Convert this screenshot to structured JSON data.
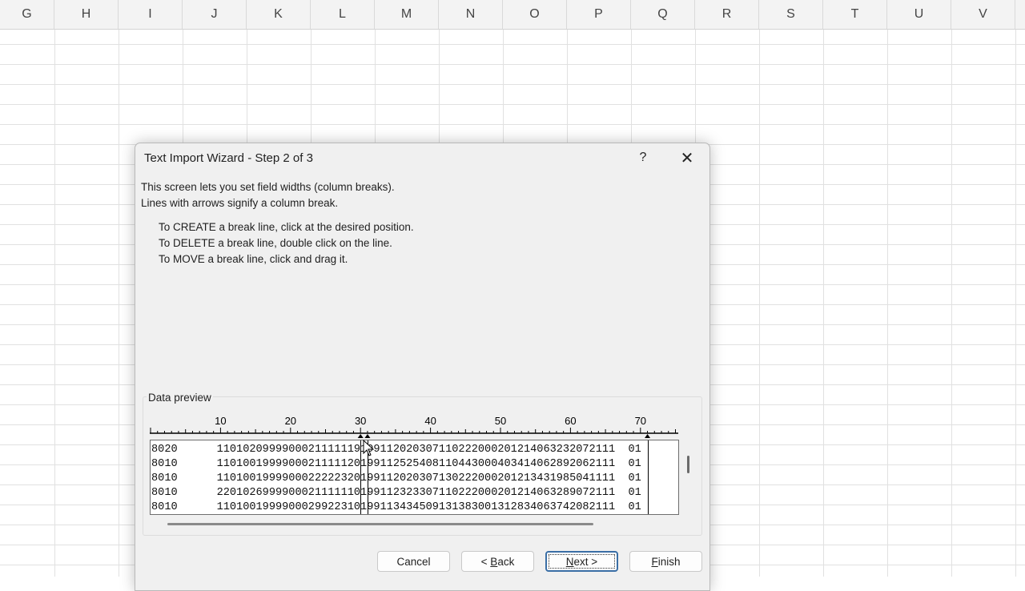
{
  "sheet": {
    "columns": [
      "G",
      "H",
      "I",
      "J",
      "K",
      "L",
      "M",
      "N",
      "O",
      "P",
      "Q",
      "R",
      "S",
      "T",
      "U",
      "V"
    ]
  },
  "dialog": {
    "title": "Text Import Wizard - Step 2 of 3",
    "help_label": "?",
    "close_label": "✕",
    "intro_line1": "This screen lets you set field widths (column breaks).",
    "intro_line2": "Lines with arrows signify a column break.",
    "instruction_create": "To CREATE a break line, click at the desired position.",
    "instruction_delete": "To DELETE a break line, double click on the line.",
    "instruction_move": "To MOVE a break line, click and drag it.",
    "data_preview_label": "Data preview",
    "ruler_labels": [
      "10",
      "20",
      "30",
      "40",
      "50",
      "60",
      "70"
    ],
    "preview_rows": [
      "8020      1101020999900021111119199112020307110222000201214063232072111  01",
      "8010      1101001999900021111120199112525408110443000403414062892062111  01",
      "8010      1101001999900022222320199112020307130222000201213431985041111  01",
      "8010      2201026999900021111110199112323307110222000201214063289072111  01",
      "8010      1101001999900029922310199113434509131383001312834063742082111  01"
    ],
    "break_positions": [
      30,
      31,
      71
    ],
    "buttons": {
      "cancel": "Cancel",
      "back_prefix": "< ",
      "back_accel": "B",
      "back_rest": "ack",
      "next_accel": "N",
      "next_rest": "ext >",
      "finish_accel": "F",
      "finish_rest": "inish"
    }
  }
}
